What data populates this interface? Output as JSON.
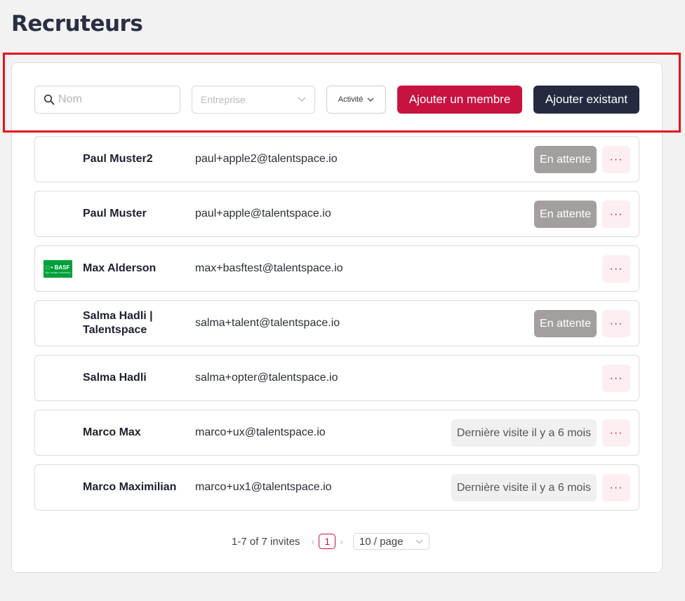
{
  "page": {
    "title": "Recruteurs"
  },
  "toolbar": {
    "search_placeholder": "Nom",
    "company_placeholder": "Entreprise",
    "activity_label": "Activité",
    "add_member_label": "Ajouter un membre",
    "add_existing_label": "Ajouter existant",
    "accent_color": "#c8123f",
    "dark_color": "#252a41"
  },
  "recruiters": [
    {
      "name": "Paul Muster2",
      "email": "paul+apple2@talentspace.io",
      "status": "En attente",
      "status_type": "pending",
      "logo": ""
    },
    {
      "name": "Paul Muster",
      "email": "paul+apple@talentspace.io",
      "status": "En attente",
      "status_type": "pending",
      "logo": ""
    },
    {
      "name": "Max Alderson",
      "email": "max+basftest@talentspace.io",
      "status": "",
      "status_type": "",
      "logo": "BASF"
    },
    {
      "name": "Salma Hadli | Talentspace",
      "email": "salma+talent@talentspace.io",
      "status": "En attente",
      "status_type": "pending",
      "logo": ""
    },
    {
      "name": "Salma Hadli",
      "email": "salma+opter@talentspace.io",
      "status": "",
      "status_type": "",
      "logo": ""
    },
    {
      "name": "Marco Max",
      "email": "marco+ux@talentspace.io",
      "status": "Dernière visite il y a 6 mois",
      "status_type": "visit",
      "logo": ""
    },
    {
      "name": "Marco Maximilian",
      "email": "marco+ux1@talentspace.io",
      "status": "Dernière visite il y a 6 mois",
      "status_type": "visit",
      "logo": ""
    }
  ],
  "row_menu_label": "···",
  "basf_logo": {
    "mark": "□ • BASF",
    "tagline": "We create chemistry"
  },
  "pagination": {
    "summary": "1-7 of 7 invites",
    "current_page": "1",
    "prev": "‹",
    "next": "›",
    "page_size": "10 / page"
  }
}
